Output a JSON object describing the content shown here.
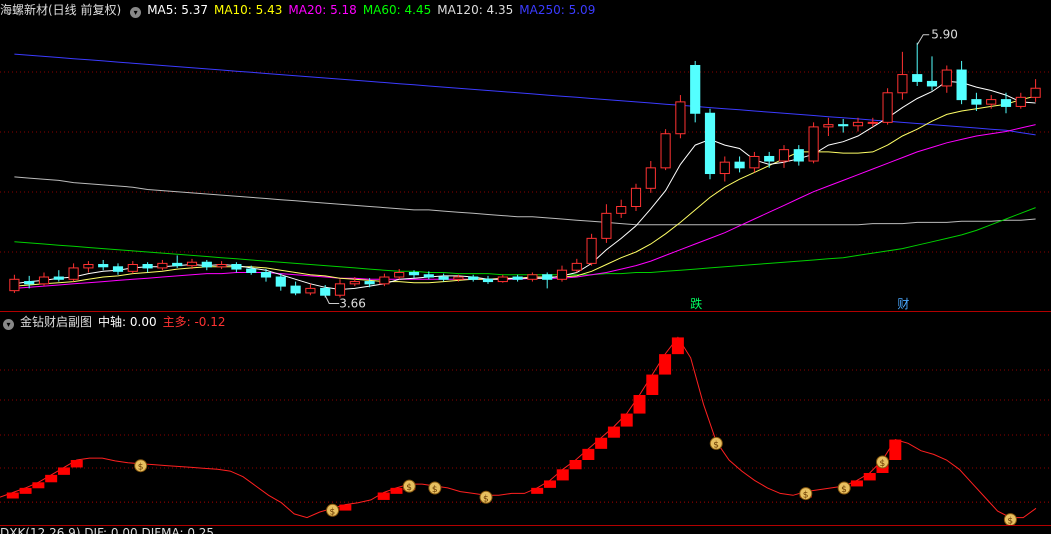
{
  "main_header": {
    "stock": "海螺新材(日线 前复权)",
    "ma": [
      {
        "label": "MA5: 5.37",
        "color": "#ffffff"
      },
      {
        "label": "MA10: 5.43",
        "color": "#ffff00"
      },
      {
        "label": "MA20: 5.18",
        "color": "#ff00ff"
      },
      {
        "label": "MA60: 4.45",
        "color": "#00ff00"
      },
      {
        "label": "MA120: 4.35",
        "color": "#dddddd"
      },
      {
        "label": "MA250: 5.09",
        "color": "#3b3bff"
      }
    ]
  },
  "main_annotations": {
    "high": "5.90",
    "low": "3.66",
    "tag1": "跌",
    "tag2": "财"
  },
  "sub_header": {
    "title": "金钻财启副图",
    "mid_label": "中轴: 0.00",
    "main_label": "主多: -0.12"
  },
  "bottom_header": {
    "text": "DXK(12,26,9) DIF: 0.00 DIFMA: 0.25"
  },
  "colors": {
    "up": "#ff3232",
    "down": "#54ffff",
    "grid": "#8b0000"
  },
  "chart_data": {
    "type": "candlestick",
    "candles": [
      [
        3.72,
        3.82,
        3.86,
        3.7
      ],
      [
        3.8,
        3.78,
        3.85,
        3.74
      ],
      [
        3.78,
        3.84,
        3.88,
        3.76
      ],
      [
        3.84,
        3.82,
        3.9,
        3.8
      ],
      [
        3.82,
        3.92,
        3.96,
        3.8
      ],
      [
        3.92,
        3.95,
        3.98,
        3.88
      ],
      [
        3.95,
        3.93,
        3.99,
        3.9
      ],
      [
        3.93,
        3.89,
        3.96,
        3.86
      ],
      [
        3.89,
        3.95,
        3.98,
        3.87
      ],
      [
        3.95,
        3.92,
        3.97,
        3.88
      ],
      [
        3.92,
        3.96,
        3.99,
        3.9
      ],
      [
        3.96,
        3.94,
        4.03,
        3.92
      ],
      [
        3.94,
        3.97,
        4.0,
        3.91
      ],
      [
        3.97,
        3.93,
        3.99,
        3.9
      ],
      [
        3.93,
        3.95,
        3.98,
        3.91
      ],
      [
        3.95,
        3.91,
        3.97,
        3.88
      ],
      [
        3.91,
        3.88,
        3.94,
        3.86
      ],
      [
        3.88,
        3.84,
        3.91,
        3.8
      ],
      [
        3.84,
        3.76,
        3.87,
        3.72
      ],
      [
        3.76,
        3.7,
        3.8,
        3.68
      ],
      [
        3.7,
        3.74,
        3.78,
        3.68
      ],
      [
        3.74,
        3.68,
        3.77,
        3.66
      ],
      [
        3.68,
        3.78,
        3.82,
        3.66
      ],
      [
        3.78,
        3.8,
        3.84,
        3.76
      ],
      [
        3.8,
        3.78,
        3.83,
        3.75
      ],
      [
        3.78,
        3.84,
        3.87,
        3.76
      ],
      [
        3.84,
        3.88,
        3.91,
        3.82
      ],
      [
        3.88,
        3.86,
        3.9,
        3.83
      ],
      [
        3.86,
        3.84,
        3.89,
        3.82
      ],
      [
        3.84,
        3.82,
        3.87,
        3.8
      ],
      [
        3.82,
        3.84,
        3.86,
        3.8
      ],
      [
        3.84,
        3.82,
        3.86,
        3.8
      ],
      [
        3.82,
        3.8,
        3.85,
        3.78
      ],
      [
        3.8,
        3.84,
        3.86,
        3.79
      ],
      [
        3.84,
        3.82,
        3.86,
        3.8
      ],
      [
        3.82,
        3.86,
        3.88,
        3.8
      ],
      [
        3.86,
        3.82,
        3.88,
        3.74
      ],
      [
        3.82,
        3.9,
        3.94,
        3.8
      ],
      [
        3.9,
        3.96,
        4.0,
        3.88
      ],
      [
        3.96,
        4.18,
        4.22,
        3.94
      ],
      [
        4.18,
        4.4,
        4.48,
        4.14
      ],
      [
        4.4,
        4.46,
        4.52,
        4.36
      ],
      [
        4.46,
        4.62,
        4.66,
        4.42
      ],
      [
        4.62,
        4.8,
        4.86,
        4.58
      ],
      [
        4.8,
        5.1,
        5.14,
        4.78
      ],
      [
        5.1,
        5.38,
        5.44,
        5.06
      ],
      [
        5.7,
        5.28,
        5.74,
        5.2
      ],
      [
        5.28,
        4.75,
        5.32,
        4.7
      ],
      [
        4.75,
        4.85,
        4.9,
        4.68
      ],
      [
        4.85,
        4.8,
        4.9,
        4.76
      ],
      [
        4.8,
        4.9,
        4.94,
        4.76
      ],
      [
        4.9,
        4.86,
        4.94,
        4.8
      ],
      [
        4.86,
        4.96,
        5.0,
        4.8
      ],
      [
        4.96,
        4.86,
        5.0,
        4.82
      ],
      [
        4.86,
        5.16,
        5.2,
        4.84
      ],
      [
        5.16,
        5.18,
        5.24,
        5.08
      ],
      [
        5.18,
        5.17,
        5.23,
        5.11
      ],
      [
        5.17,
        5.2,
        5.24,
        5.12
      ],
      [
        5.2,
        5.2,
        5.24,
        5.16
      ],
      [
        5.2,
        5.46,
        5.5,
        5.18
      ],
      [
        5.46,
        5.62,
        5.82,
        5.4
      ],
      [
        5.62,
        5.56,
        5.9,
        5.52
      ],
      [
        5.56,
        5.52,
        5.78,
        5.48
      ],
      [
        5.52,
        5.66,
        5.7,
        5.46
      ],
      [
        5.66,
        5.4,
        5.74,
        5.36
      ],
      [
        5.4,
        5.36,
        5.46,
        5.3
      ],
      [
        5.36,
        5.4,
        5.44,
        5.32
      ],
      [
        5.4,
        5.34,
        5.46,
        5.28
      ],
      [
        5.34,
        5.42,
        5.46,
        5.32
      ],
      [
        5.42,
        5.5,
        5.58,
        5.38
      ]
    ],
    "ma5": [
      3.78,
      3.8,
      3.81,
      3.83,
      3.84,
      3.87,
      3.89,
      3.9,
      3.92,
      3.93,
      3.93,
      3.94,
      3.95,
      3.94,
      3.95,
      3.94,
      3.92,
      3.9,
      3.86,
      3.82,
      3.78,
      3.75,
      3.73,
      3.74,
      3.76,
      3.78,
      3.82,
      3.83,
      3.84,
      3.85,
      3.85,
      3.84,
      3.82,
      3.82,
      3.83,
      3.83,
      3.83,
      3.85,
      3.88,
      3.96,
      4.08,
      4.18,
      4.29,
      4.44,
      4.6,
      4.83,
      5.0,
      5.05,
      5.0,
      4.97,
      4.87,
      4.83,
      4.85,
      4.88,
      4.92,
      5.0,
      5.03,
      5.08,
      5.16,
      5.24,
      5.33,
      5.41,
      5.47,
      5.56,
      5.55,
      5.51,
      5.48,
      5.44,
      5.38,
      5.37
    ],
    "ma10": [
      3.76,
      3.77,
      3.78,
      3.79,
      3.8,
      3.82,
      3.84,
      3.85,
      3.87,
      3.88,
      3.89,
      3.91,
      3.92,
      3.93,
      3.93,
      3.93,
      3.93,
      3.92,
      3.9,
      3.88,
      3.86,
      3.85,
      3.83,
      3.82,
      3.81,
      3.8,
      3.8,
      3.79,
      3.79,
      3.8,
      3.81,
      3.82,
      3.82,
      3.83,
      3.83,
      3.84,
      3.84,
      3.84,
      3.85,
      3.89,
      3.95,
      4.01,
      4.06,
      4.13,
      4.22,
      4.32,
      4.43,
      4.54,
      4.63,
      4.7,
      4.76,
      4.82,
      4.88,
      4.94,
      4.94,
      4.94,
      4.93,
      4.93,
      4.94,
      5.0,
      5.08,
      5.14,
      5.21,
      5.27,
      5.3,
      5.32,
      5.34,
      5.36,
      5.4,
      5.43
    ],
    "ma20": [
      3.74,
      3.75,
      3.76,
      3.77,
      3.78,
      3.79,
      3.8,
      3.81,
      3.82,
      3.83,
      3.84,
      3.85,
      3.86,
      3.87,
      3.87,
      3.88,
      3.88,
      3.88,
      3.87,
      3.86,
      3.85,
      3.84,
      3.83,
      3.83,
      3.82,
      3.82,
      3.82,
      3.82,
      3.82,
      3.82,
      3.82,
      3.82,
      3.82,
      3.82,
      3.82,
      3.83,
      3.83,
      3.83,
      3.84,
      3.86,
      3.88,
      3.91,
      3.94,
      3.98,
      4.03,
      4.08,
      4.13,
      4.18,
      4.23,
      4.29,
      4.35,
      4.41,
      4.47,
      4.53,
      4.59,
      4.64,
      4.69,
      4.74,
      4.79,
      4.84,
      4.89,
      4.94,
      4.98,
      5.02,
      5.05,
      5.08,
      5.1,
      5.12,
      5.15,
      5.18
    ],
    "ma60": [
      4.15,
      4.14,
      4.13,
      4.12,
      4.11,
      4.1,
      4.09,
      4.08,
      4.07,
      4.06,
      4.05,
      4.04,
      4.03,
      4.02,
      4.01,
      4.0,
      3.99,
      3.98,
      3.97,
      3.96,
      3.95,
      3.94,
      3.93,
      3.92,
      3.91,
      3.9,
      3.89,
      3.89,
      3.88,
      3.88,
      3.87,
      3.87,
      3.87,
      3.86,
      3.86,
      3.86,
      3.86,
      3.86,
      3.86,
      3.86,
      3.87,
      3.87,
      3.88,
      3.88,
      3.89,
      3.9,
      3.91,
      3.92,
      3.93,
      3.94,
      3.95,
      3.96,
      3.97,
      3.98,
      3.99,
      4.0,
      4.01,
      4.03,
      4.05,
      4.07,
      4.09,
      4.12,
      4.15,
      4.18,
      4.21,
      4.25,
      4.3,
      4.35,
      4.4,
      4.45
    ],
    "ma120": [
      4.72,
      4.71,
      4.7,
      4.69,
      4.67,
      4.66,
      4.65,
      4.64,
      4.63,
      4.61,
      4.6,
      4.59,
      4.58,
      4.57,
      4.56,
      4.55,
      4.54,
      4.53,
      4.52,
      4.51,
      4.5,
      4.49,
      4.48,
      4.47,
      4.46,
      4.45,
      4.44,
      4.43,
      4.43,
      4.42,
      4.41,
      4.4,
      4.39,
      4.38,
      4.37,
      4.37,
      4.36,
      4.35,
      4.34,
      4.33,
      4.32,
      4.31,
      4.3,
      4.3,
      4.3,
      4.3,
      4.3,
      4.3,
      4.3,
      4.3,
      4.3,
      4.3,
      4.3,
      4.3,
      4.3,
      4.3,
      4.3,
      4.3,
      4.31,
      4.31,
      4.31,
      4.32,
      4.32,
      4.32,
      4.33,
      4.33,
      4.33,
      4.34,
      4.34,
      4.35
    ],
    "ma250": [
      5.8,
      5.79,
      5.78,
      5.77,
      5.76,
      5.75,
      5.74,
      5.73,
      5.72,
      5.71,
      5.7,
      5.69,
      5.68,
      5.67,
      5.66,
      5.65,
      5.64,
      5.63,
      5.62,
      5.61,
      5.6,
      5.59,
      5.58,
      5.57,
      5.56,
      5.55,
      5.54,
      5.53,
      5.52,
      5.51,
      5.5,
      5.49,
      5.48,
      5.47,
      5.46,
      5.45,
      5.44,
      5.43,
      5.42,
      5.41,
      5.4,
      5.39,
      5.38,
      5.37,
      5.36,
      5.35,
      5.34,
      5.33,
      5.32,
      5.31,
      5.3,
      5.29,
      5.28,
      5.27,
      5.26,
      5.25,
      5.24,
      5.23,
      5.22,
      5.21,
      5.2,
      5.19,
      5.18,
      5.17,
      5.16,
      5.15,
      5.14,
      5.13,
      5.11,
      5.09
    ],
    "sub_values": [
      0.0,
      0.05,
      0.1,
      0.16,
      0.24,
      0.32,
      0.4,
      0.42,
      0.42,
      0.39,
      0.37,
      0.36,
      0.35,
      0.34,
      0.33,
      0.32,
      0.31,
      0.3,
      0.28,
      0.22,
      0.12,
      0.02,
      -0.06,
      -0.18,
      -0.22,
      -0.16,
      -0.12,
      -0.08,
      -0.06,
      -0.03,
      0.05,
      0.1,
      0.14,
      0.14,
      0.12,
      0.1,
      0.06,
      0.04,
      0.02,
      0.02,
      0.04,
      0.04,
      0.1,
      0.18,
      0.3,
      0.4,
      0.52,
      0.64,
      0.76,
      0.9,
      1.1,
      1.32,
      1.54,
      1.72,
      1.5,
      1.0,
      0.6,
      0.4,
      0.28,
      0.18,
      0.1,
      0.04,
      0.02,
      0.06,
      0.08,
      0.1,
      0.12,
      0.18,
      0.26,
      0.4,
      0.62,
      0.58,
      0.5,
      0.46,
      0.4,
      0.3,
      0.15,
      0.0,
      -0.15,
      -0.22,
      -0.22,
      -0.12
    ],
    "sub_markers": [
      11,
      26,
      32,
      34,
      38,
      56,
      63,
      66,
      69,
      79
    ]
  }
}
